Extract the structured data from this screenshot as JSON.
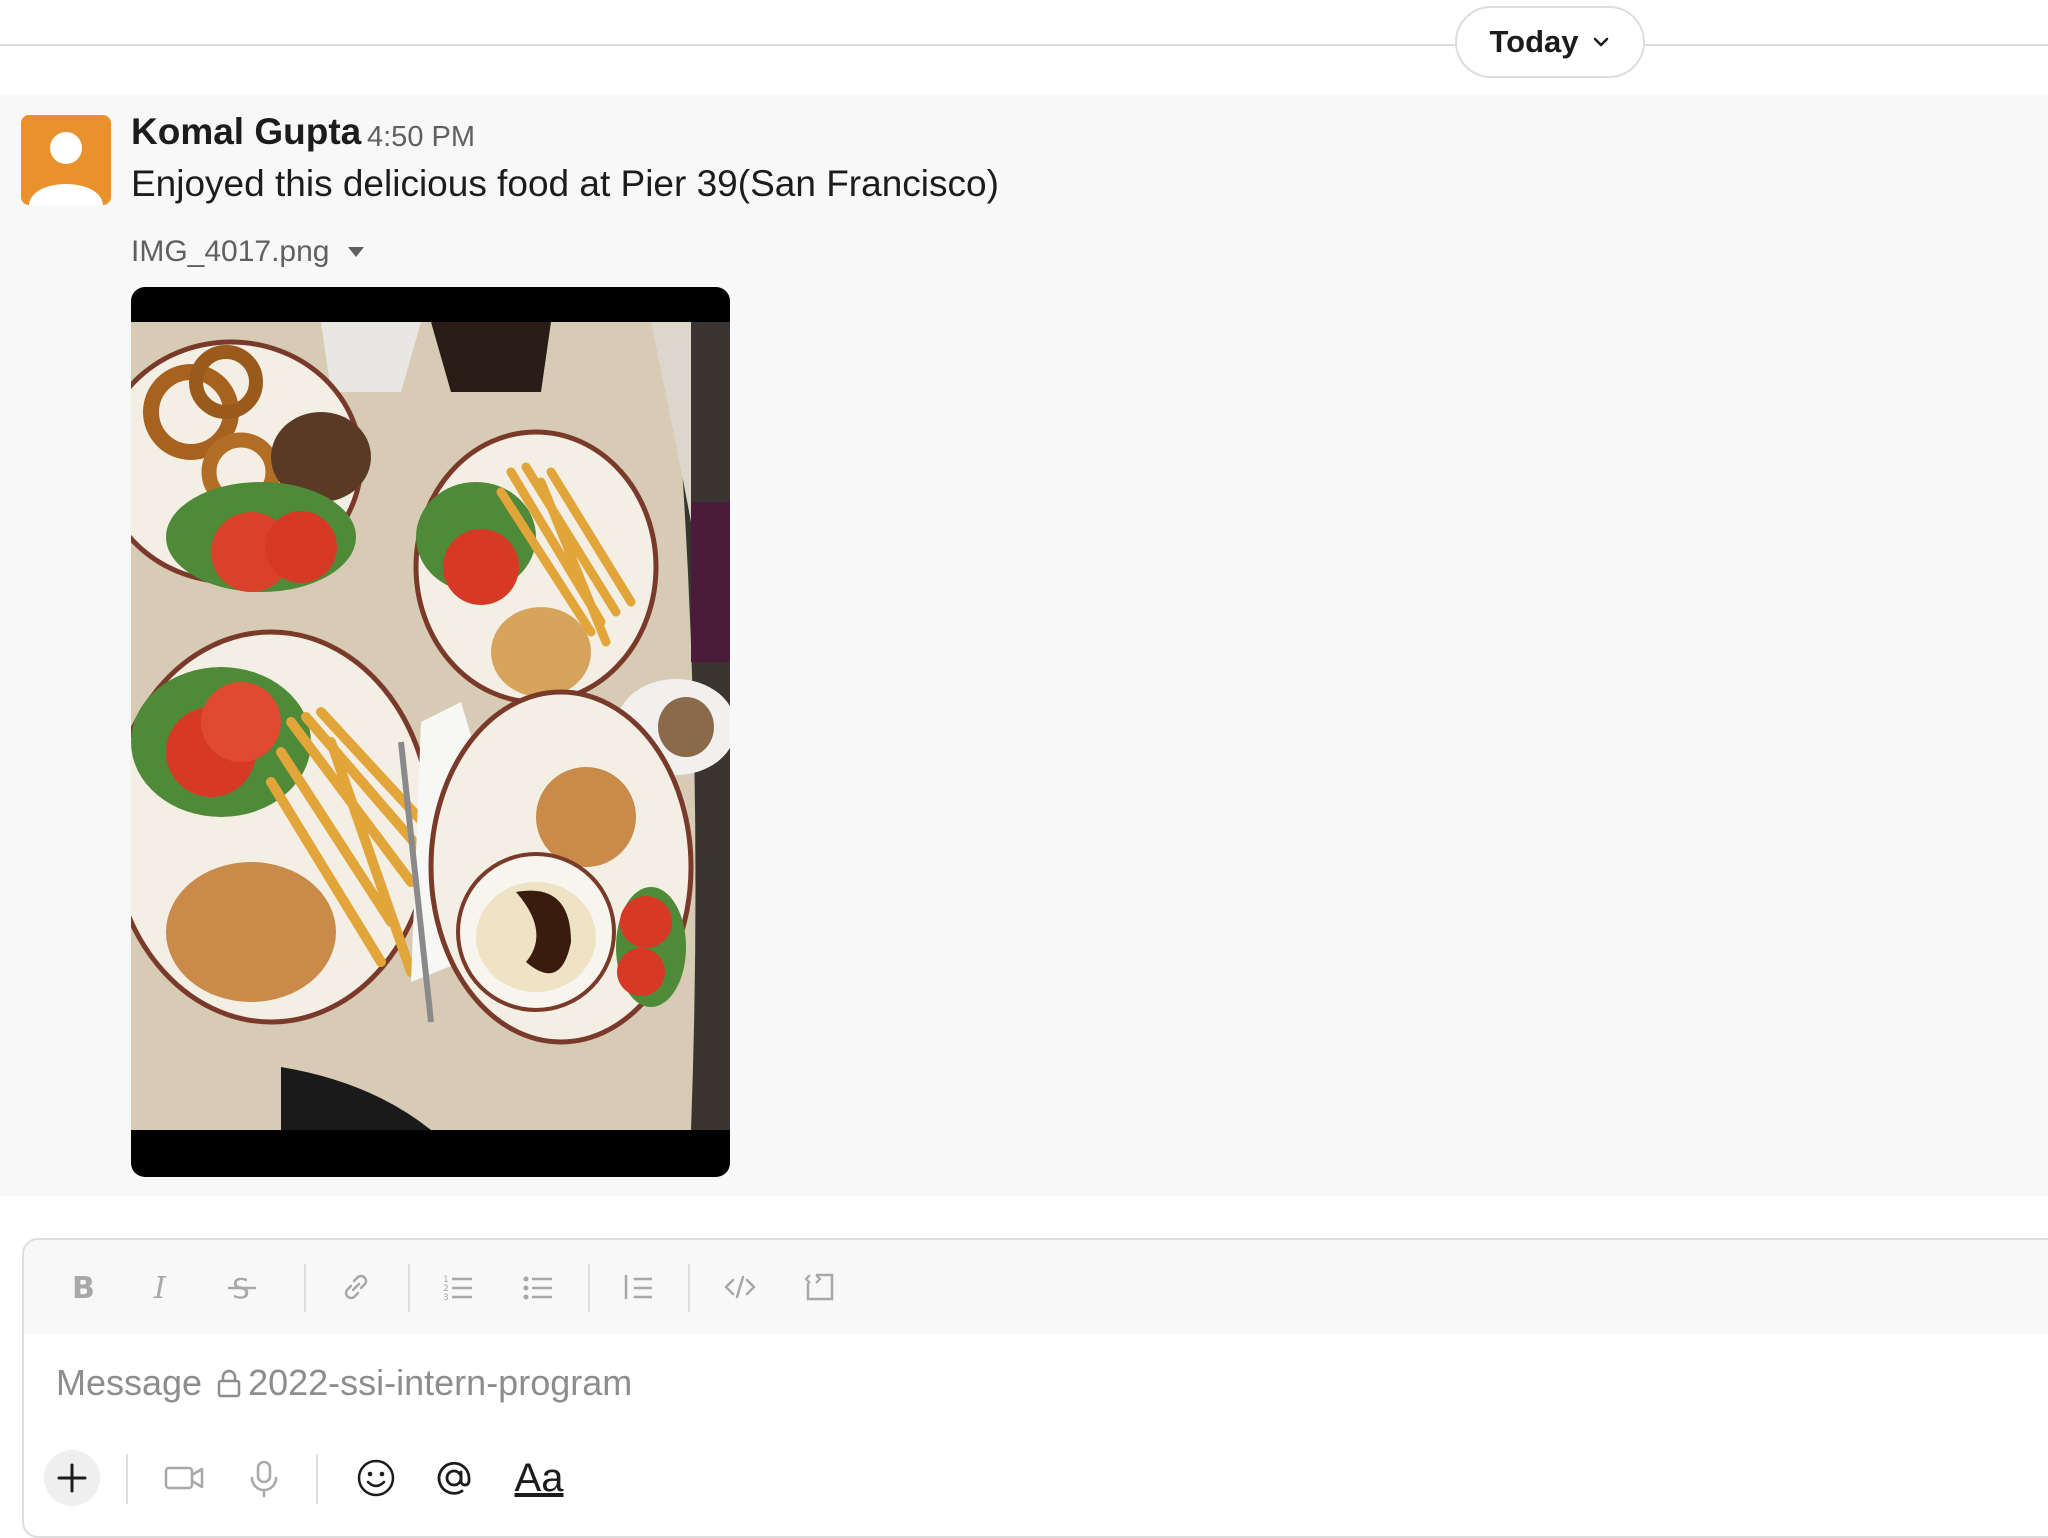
{
  "date_divider": {
    "label": "Today",
    "icon": "chevron-down-icon"
  },
  "message": {
    "sender": "Komal Gupta",
    "time": "4:50 PM",
    "text": "Enjoyed this delicious food at Pier 39(San Francisco)",
    "attachment": {
      "filename": "IMG_4017.png",
      "icon": "caret-down-icon"
    }
  },
  "composer": {
    "placeholder_prefix": "Message",
    "channel": "2022-ssi-intern-program",
    "format_buttons": [
      "bold-icon",
      "italic-icon",
      "strikethrough-icon",
      "link-icon",
      "ordered-list-icon",
      "bulleted-list-icon",
      "blockquote-icon",
      "code-icon",
      "code-block-icon"
    ],
    "action_buttons": [
      "plus-icon",
      "video-icon",
      "microphone-icon",
      "emoji-icon",
      "mention-icon"
    ],
    "text_format_label": "Aa"
  },
  "colors": {
    "avatar": "#e8912d",
    "background": "#f8f8f8",
    "muted": "#616061"
  }
}
